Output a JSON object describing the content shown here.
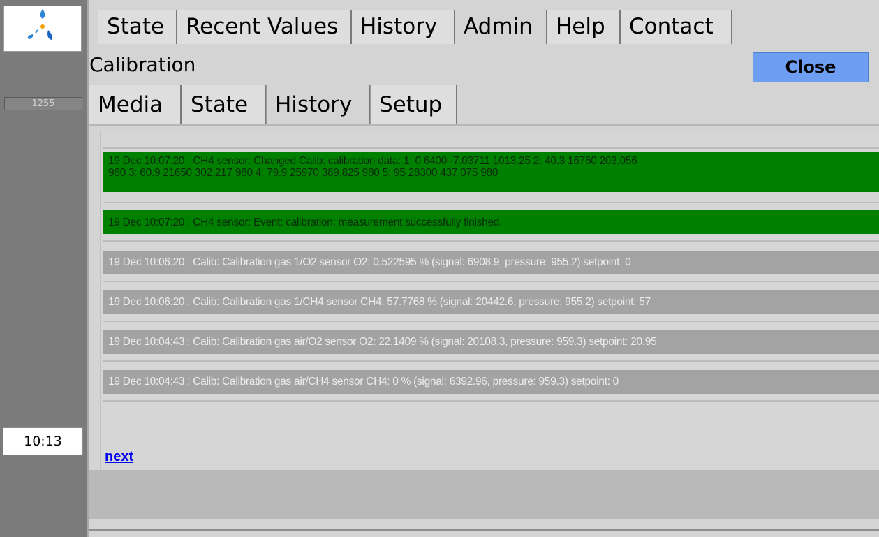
{
  "sidebar": {
    "counter": "1255",
    "clock": "10:13"
  },
  "main_tabs": [
    "State",
    "Recent Values",
    "History",
    "Admin",
    "Help",
    "Contact"
  ],
  "active_main_tab": "Admin",
  "page": {
    "title": "Calibration",
    "close_label": "Close"
  },
  "sub_tabs": [
    "Media",
    "State",
    "History",
    "Setup"
  ],
  "active_sub_tab": "History",
  "history": {
    "entries": [
      {
        "text": "19 Dec 10:07:20 : CH4 sensor: Changed Calib: calibration data: 1: 0 6400 -7.03711 1013.25 2: 40.3 16760 203.056",
        "text2": "980 3: 60.9 21650 302.217 980 4: 79.9 25970 389.825 980 5: 95 28300 437.075 980",
        "status": "event"
      },
      {
        "text": "19 Dec 10:07:20 : CH4 sensor: Event: calibration: measurement successfully finished.",
        "status": "event"
      },
      {
        "text": "19 Dec 10:06:20 : Calib: Calibration gas 1/O2 sensor O2: 0.522595 % (signal: 6908.9, pressure: 955.2) setpoint: 0",
        "status": "info"
      },
      {
        "text": "19 Dec 10:06:20 : Calib: Calibration gas 1/CH4 sensor CH4: 57.7768 % (signal: 20442.6, pressure: 955.2) setpoint: 57",
        "status": "info"
      },
      {
        "text": "19 Dec 10:04:43 : Calib: Calibration gas air/O2 sensor O2: 22.1409 % (signal: 20108.3, pressure: 959.3) setpoint: 20.95",
        "status": "info"
      },
      {
        "text": "19 Dec 10:04:43 : Calib: Calibration gas air/CH4 sensor CH4: 0 % (signal: 6392.96, pressure: 959.3) setpoint: 0",
        "status": "info"
      }
    ],
    "next_label": "next"
  },
  "colors": {
    "event": "#008000",
    "info": "#a3a3a3",
    "close_button": "#6e9ef2",
    "sidebar": "#7b7b7b"
  },
  "icons": {
    "logo": "drop-cluster-logo-icon"
  }
}
